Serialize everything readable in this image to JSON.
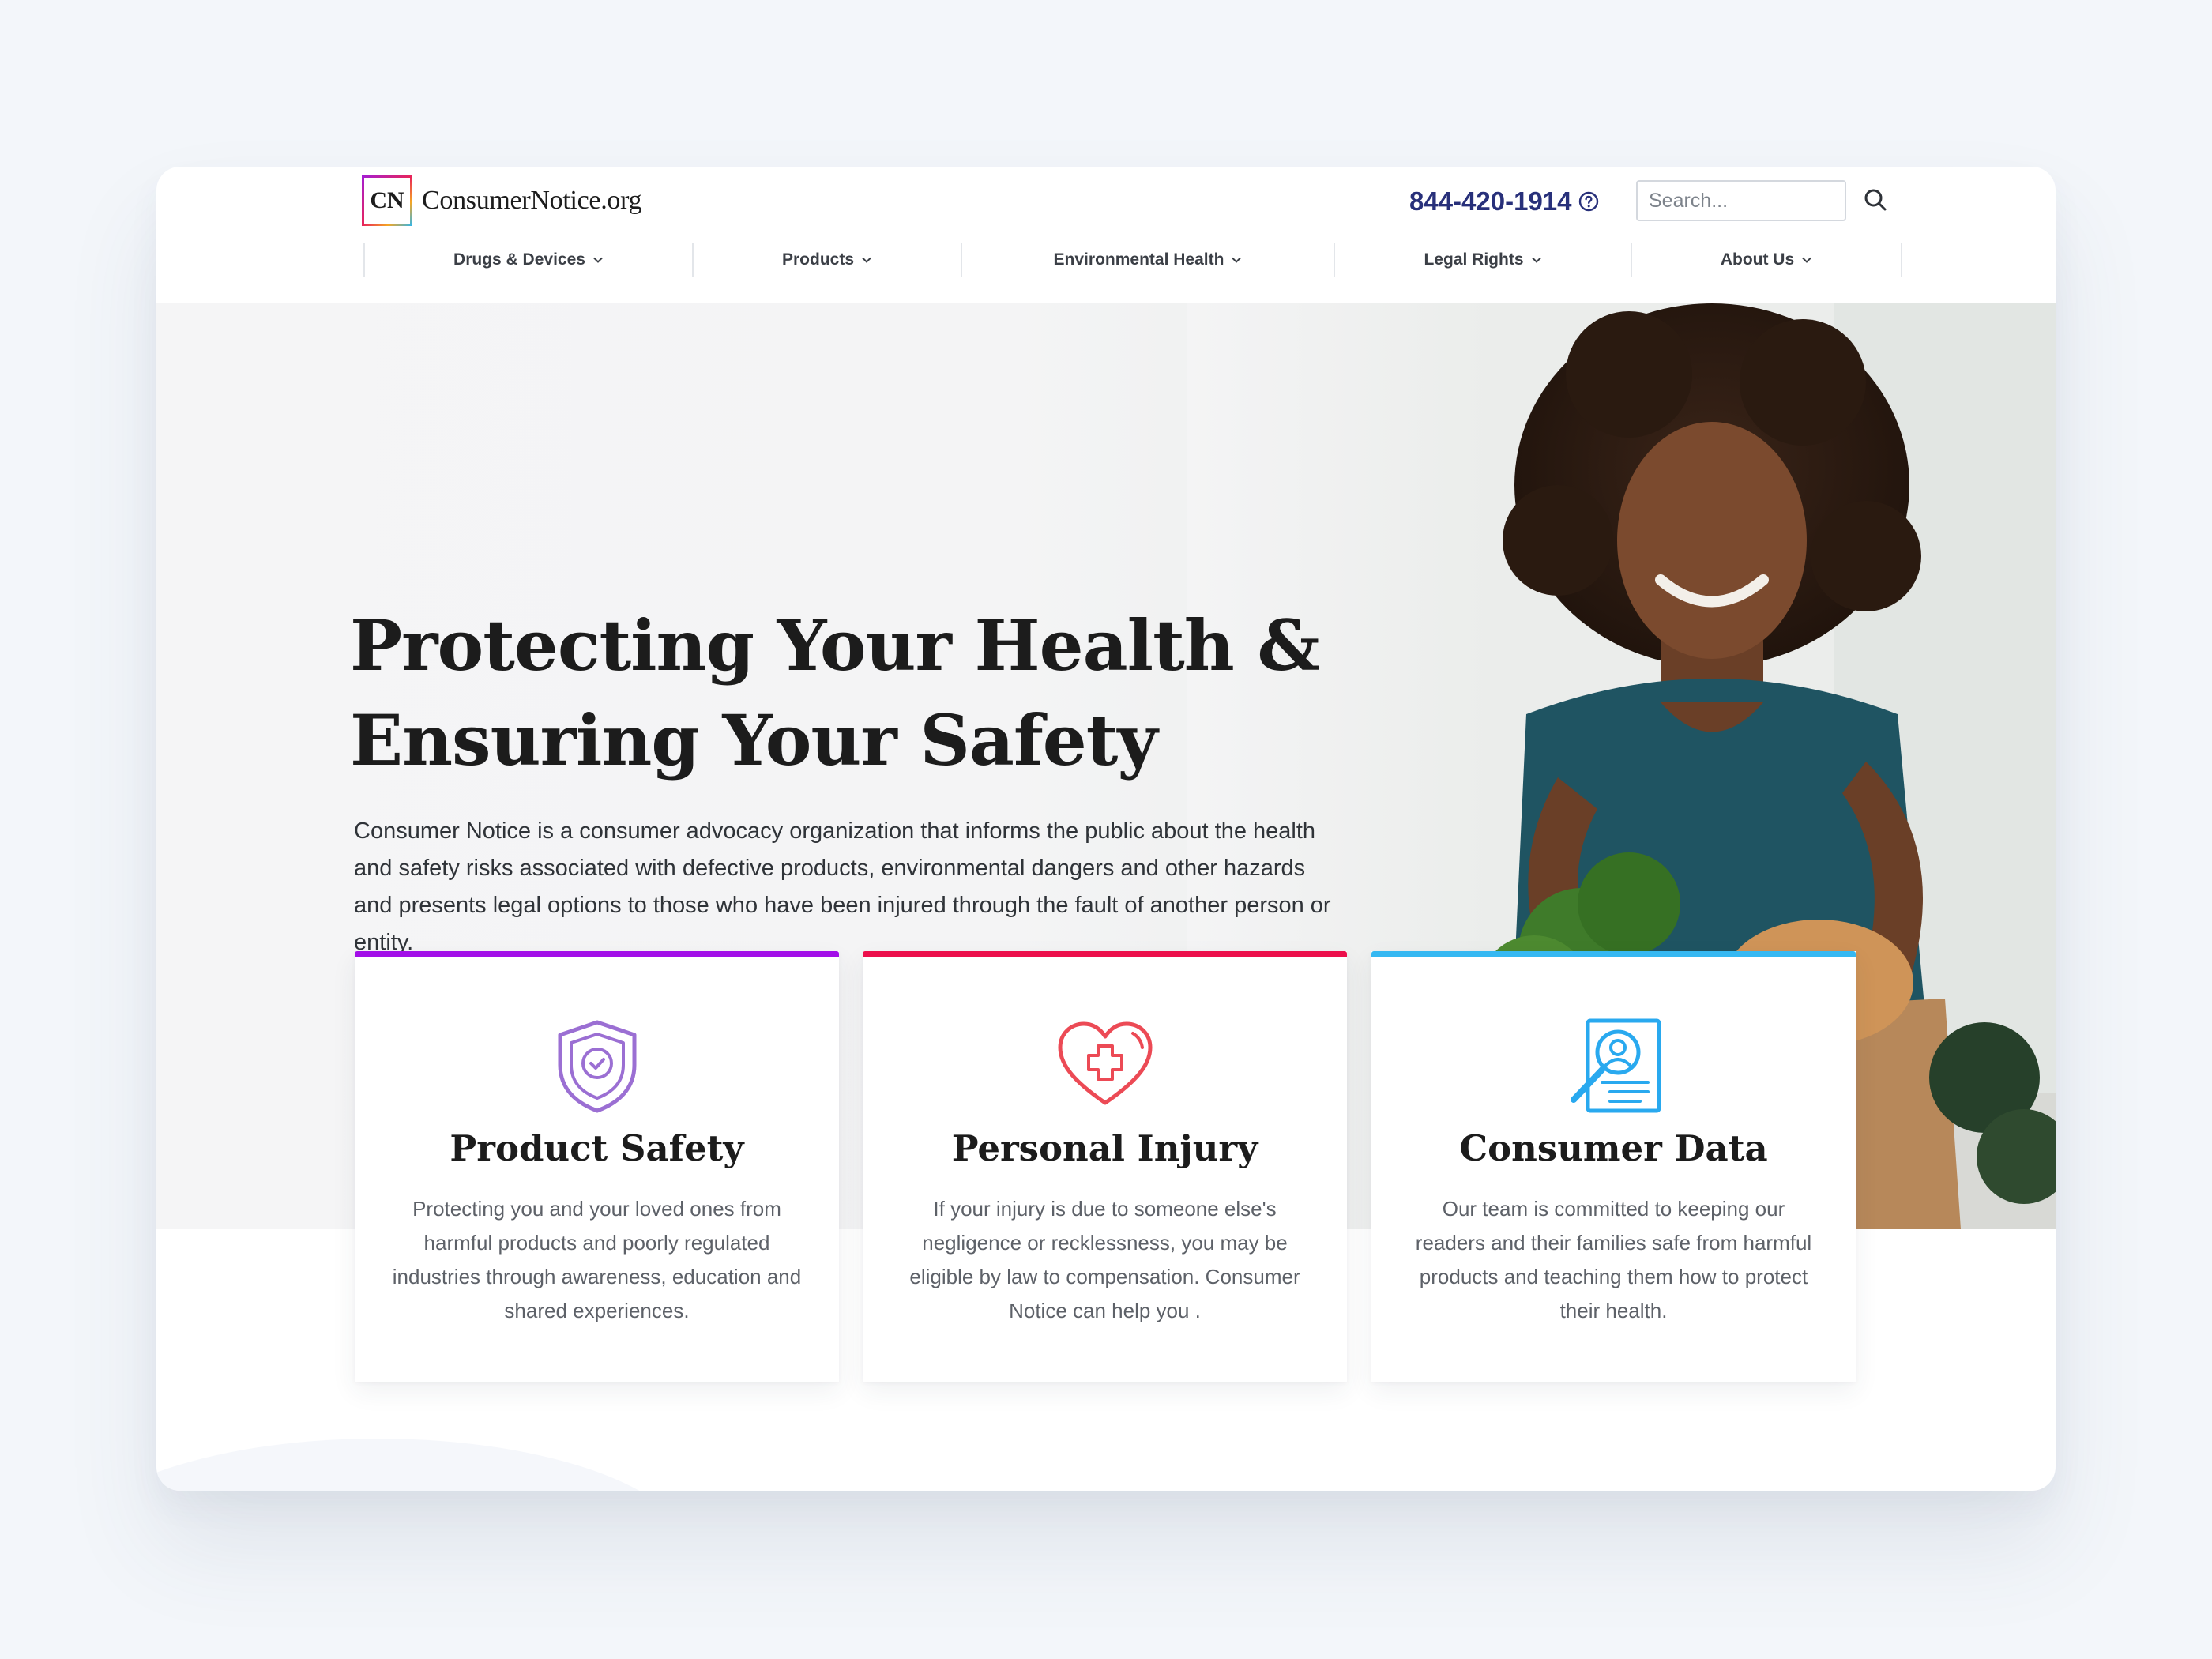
{
  "header": {
    "logo_mark": "CN",
    "logo_text": "ConsumerNotice.org",
    "phone": "844-420-1914",
    "search_placeholder": "Search..."
  },
  "nav": {
    "items": [
      {
        "label": "Drugs & Devices"
      },
      {
        "label": "Products"
      },
      {
        "label": "Environmental Health"
      },
      {
        "label": "Legal Rights"
      },
      {
        "label": "About Us"
      }
    ]
  },
  "hero": {
    "title_line1": "Protecting Your Health &",
    "title_line2": "Ensuring Your Safety",
    "description": "Consumer Notice is a consumer advocacy organization that informs the public about the health and safety risks associated with defective products, environmental dangers and other hazards and presents legal options to those who have been injured through the fault of another person or entity."
  },
  "cards": [
    {
      "title": "Product Safety",
      "text": "Protecting you and your loved ones from harmful products and poorly regulated industries through awareness, education and shared experiences.",
      "accent": "#a20ee8",
      "icon": "shield-check-icon"
    },
    {
      "title": "Personal Injury",
      "text": "If your injury is due to someone else's negligence or recklessness, you may be eligible by law to compensation. Consumer Notice can help you .",
      "accent": "#ec0f4b",
      "icon": "heart-cross-icon"
    },
    {
      "title": "Consumer Data",
      "text": "Our team is committed to keeping our readers and their families safe from harmful products and teaching them how to protect their health.",
      "accent": "#35b8f2",
      "icon": "profile-search-icon"
    }
  ],
  "colors": {
    "page_bg": "#f3f6fa",
    "phone_blue": "#28307a",
    "heading": "#1c1c1c"
  }
}
